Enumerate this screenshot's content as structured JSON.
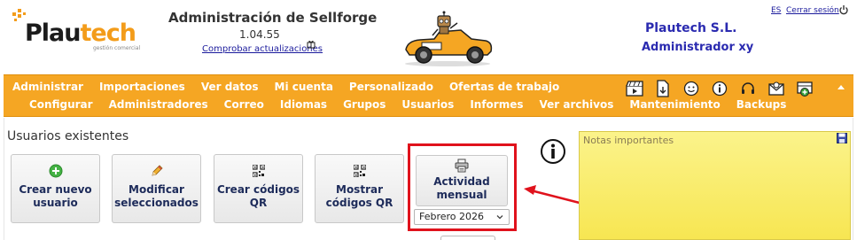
{
  "header": {
    "logo_text_dark": "Plau",
    "logo_text_accent": "tech",
    "logo_tagline": "gestión comercial",
    "app_title": "Administración de Sellforge",
    "version": "1.04.55",
    "update_link": "Comprobar actualizaciones",
    "company": "Plautech S.L.",
    "user_role": "Administrador xy",
    "language": "ES",
    "logout": "Cerrar sesión"
  },
  "nav": {
    "row1": [
      "Administrar",
      "Importaciones",
      "Ver datos",
      "Mi cuenta",
      "Personalizado",
      "Ofertas de trabajo"
    ],
    "row2": [
      "Configurar",
      "Administradores",
      "Correo",
      "Idiomas",
      "Grupos",
      "Usuarios",
      "Informes",
      "Ver archivos",
      "Mantenimiento",
      "Backups"
    ],
    "icons": [
      "clapperboard-icon",
      "document-download-icon",
      "smiley-icon",
      "info-icon",
      "headset-icon",
      "mail-at-icon",
      "inbox-plus-icon"
    ]
  },
  "main": {
    "section_title": "Usuarios existentes",
    "buttons": [
      {
        "label": "Crear nuevo usuario",
        "icon": "add-circle-icon"
      },
      {
        "label": "Modificar seleccionados",
        "icon": "pencil-icon"
      },
      {
        "label": "Crear códigos QR",
        "icon": "qr-code-icon"
      },
      {
        "label": "Mostrar códigos QR",
        "icon": "qr-code-icon"
      },
      {
        "label": "Actividad mensual",
        "icon": "printer-icon"
      }
    ],
    "month_select": "Febrero 2026"
  },
  "notes": {
    "title": "Notas importantes"
  },
  "colors": {
    "nav_orange": "#f5a623",
    "link_blue": "#1a1a9c",
    "company_blue": "#2a2ab0",
    "highlight_red": "#e0121c",
    "notes_yellow": "#f7e652"
  }
}
